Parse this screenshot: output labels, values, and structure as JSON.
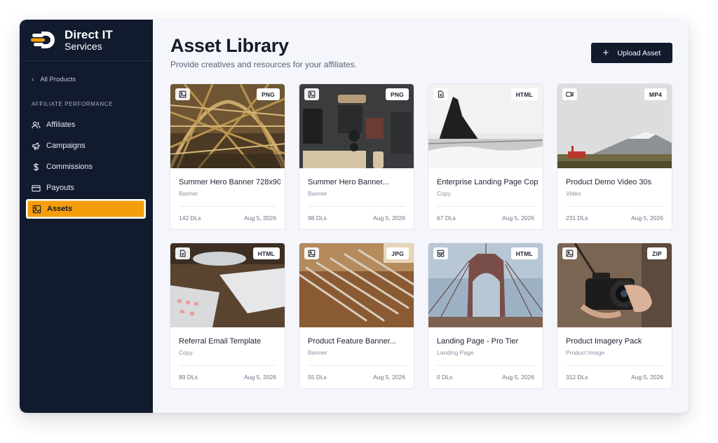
{
  "brand": {
    "name": "Direct IT",
    "sub": "Services",
    "accent": "#f59e0b",
    "sidebar_bg": "#121a2e"
  },
  "sidebar": {
    "back_label": "All Products",
    "section_label": "AFFILIATE PERFORMANCE",
    "items": [
      {
        "label": "Affiliates",
        "icon": "users-icon"
      },
      {
        "label": "Campaigns",
        "icon": "megaphone-icon"
      },
      {
        "label": "Commissions",
        "icon": "dollar-icon"
      },
      {
        "label": "Payouts",
        "icon": "credit-card-icon"
      },
      {
        "label": "Assets",
        "icon": "image-icon",
        "active": true
      }
    ]
  },
  "header": {
    "title": "Asset Library",
    "subtitle": "Provide creatives and resources for your affiliates.",
    "upload_label": "Upload Asset"
  },
  "assets": [
    {
      "title": "Summer Hero Banner 728x90",
      "category": "Banner",
      "format": "PNG",
      "type_icon": "image-icon",
      "downloads": "142 DLs",
      "date": "Aug 5, 2026"
    },
    {
      "title": "Summer Hero Banner...",
      "category": "Banner",
      "format": "PNG",
      "type_icon": "image-icon",
      "downloads": "98 DLs",
      "date": "Aug 5, 2026"
    },
    {
      "title": "Enterprise Landing Page Copy",
      "category": "Copy",
      "format": "HTML",
      "type_icon": "document-icon",
      "downloads": "67 DLs",
      "date": "Aug 5, 2026"
    },
    {
      "title": "Product Demo Video 30s",
      "category": "Video",
      "format": "MP4",
      "type_icon": "video-icon",
      "downloads": "231 DLs",
      "date": "Aug 5, 2026"
    },
    {
      "title": "Referral Email Template",
      "category": "Copy",
      "format": "HTML",
      "type_icon": "document-icon",
      "downloads": "89 DLs",
      "date": "Aug 5, 2026"
    },
    {
      "title": "Product Feature Banner...",
      "category": "Banner",
      "format": "JPG",
      "type_icon": "image-icon",
      "downloads": "55 DLs",
      "date": "Aug 5, 2026"
    },
    {
      "title": "Landing Page - Pro Tier",
      "category": "Landing Page",
      "format": "HTML",
      "type_icon": "layout-icon",
      "downloads": "0 DLs",
      "date": "Aug 5, 2026"
    },
    {
      "title": "Product Imagery Pack",
      "category": "Product Image",
      "format": "ZIP",
      "type_icon": "image-icon",
      "downloads": "312 DLs",
      "date": "Aug 5, 2026"
    }
  ]
}
